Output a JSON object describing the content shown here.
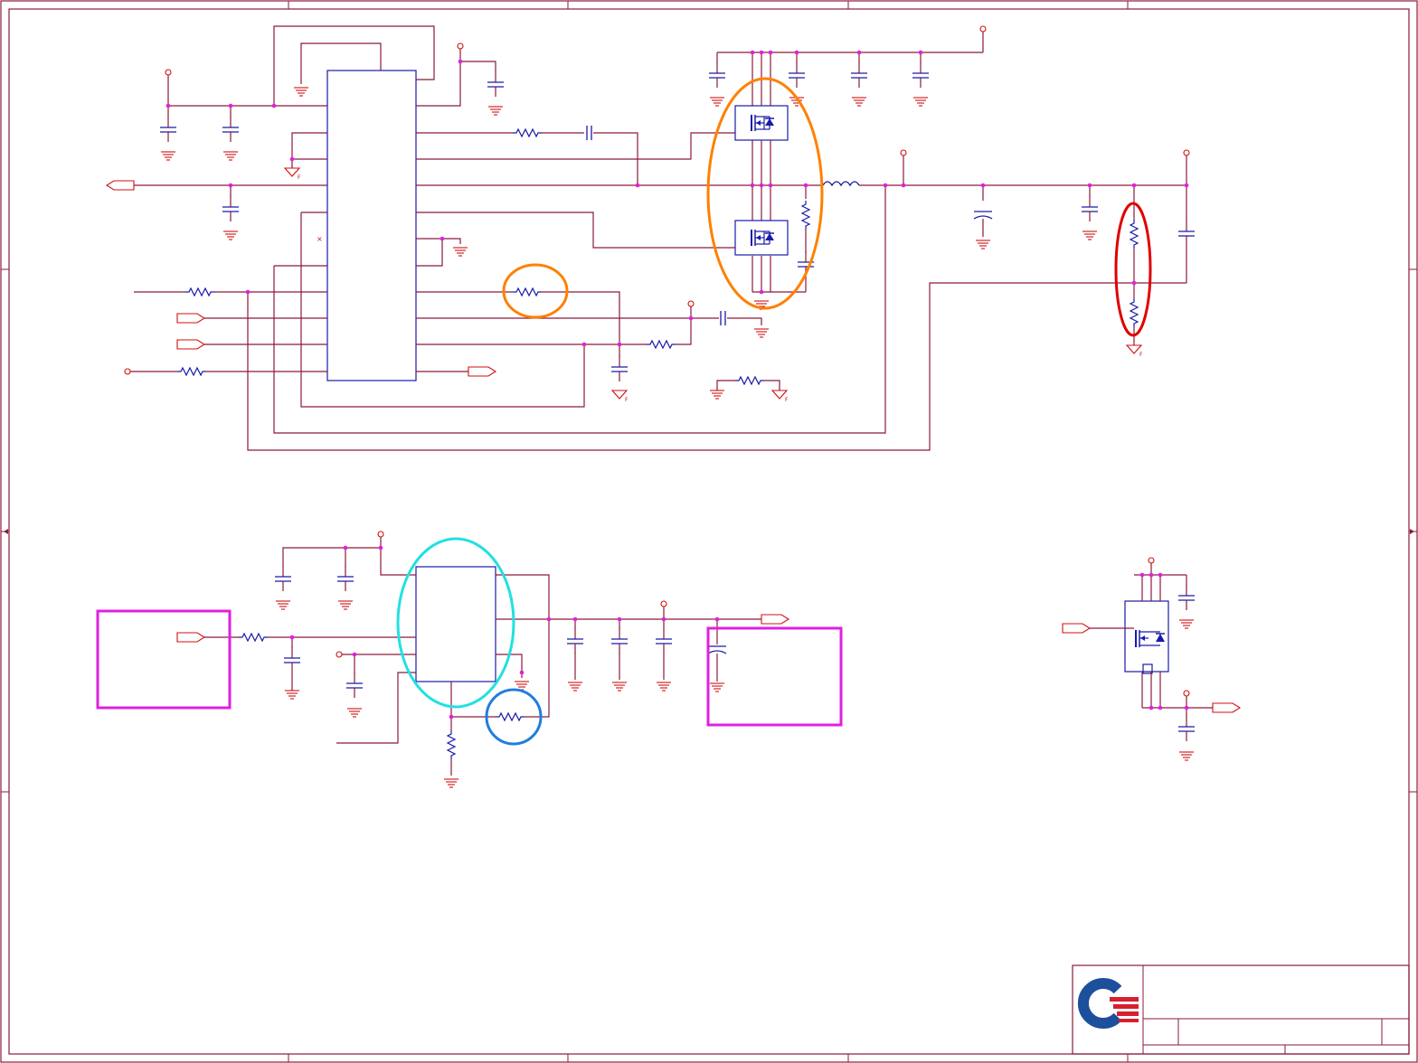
{
  "sheet": {
    "frame_color": "#8b1a3a",
    "wire_color": "#8b1a3a",
    "component_color": "#1a1aa8",
    "power_symbol_color": "#d01010",
    "junction_color": "#e020e0"
  },
  "annotations": [
    {
      "id": "upper-mosfet-pair",
      "shape": "ellipse",
      "color": "#ff8000"
    },
    {
      "id": "upper-series-resistor",
      "shape": "ellipse",
      "color": "#ff8000"
    },
    {
      "id": "feedback-divider",
      "shape": "ellipse",
      "color": "#e00000"
    },
    {
      "id": "lower-regulator-ic",
      "shape": "ellipse",
      "color": "#22e0e0"
    },
    {
      "id": "lower-feedback-resistor",
      "shape": "ellipse",
      "color": "#1e7ee0"
    },
    {
      "id": "input-note-box",
      "shape": "rectangle",
      "color": "#e020e0"
    },
    {
      "id": "output-note-box",
      "shape": "rectangle",
      "color": "#e020e0"
    }
  ],
  "title_block": {
    "logo": "company-logo-icon",
    "logo_colors": [
      "#1c4f9c",
      "#d6202e"
    ]
  }
}
